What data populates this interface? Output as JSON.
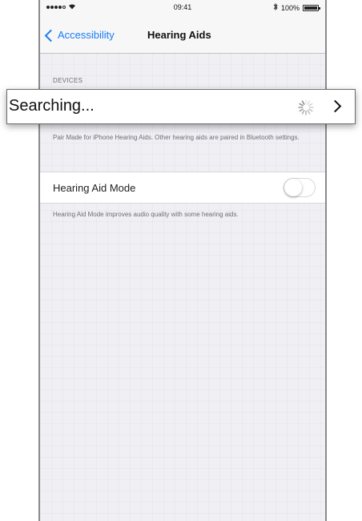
{
  "status_bar": {
    "time": "09:41",
    "battery": "100%"
  },
  "nav": {
    "back_label": "Accessibility",
    "title": "Hearing Aids"
  },
  "devices": {
    "header": "DEVICES",
    "searching_label": "Searching...",
    "footer": "Pair Made for iPhone Hearing Aids. Other hearing aids are paired in Bluetooth settings."
  },
  "hearing_aid_mode": {
    "label": "Hearing Aid Mode",
    "enabled": false,
    "footer": "Hearing Aid Mode improves audio quality with some hearing aids."
  },
  "icons": {
    "back": "chevron-left-icon",
    "disclosure": "chevron-right-icon",
    "spinner": "activity-spinner-icon",
    "wifi": "wifi-icon",
    "bluetooth": "bluetooth-icon",
    "battery": "battery-icon"
  },
  "colors": {
    "accent": "#1a7cf5",
    "background": "#efeff4"
  }
}
